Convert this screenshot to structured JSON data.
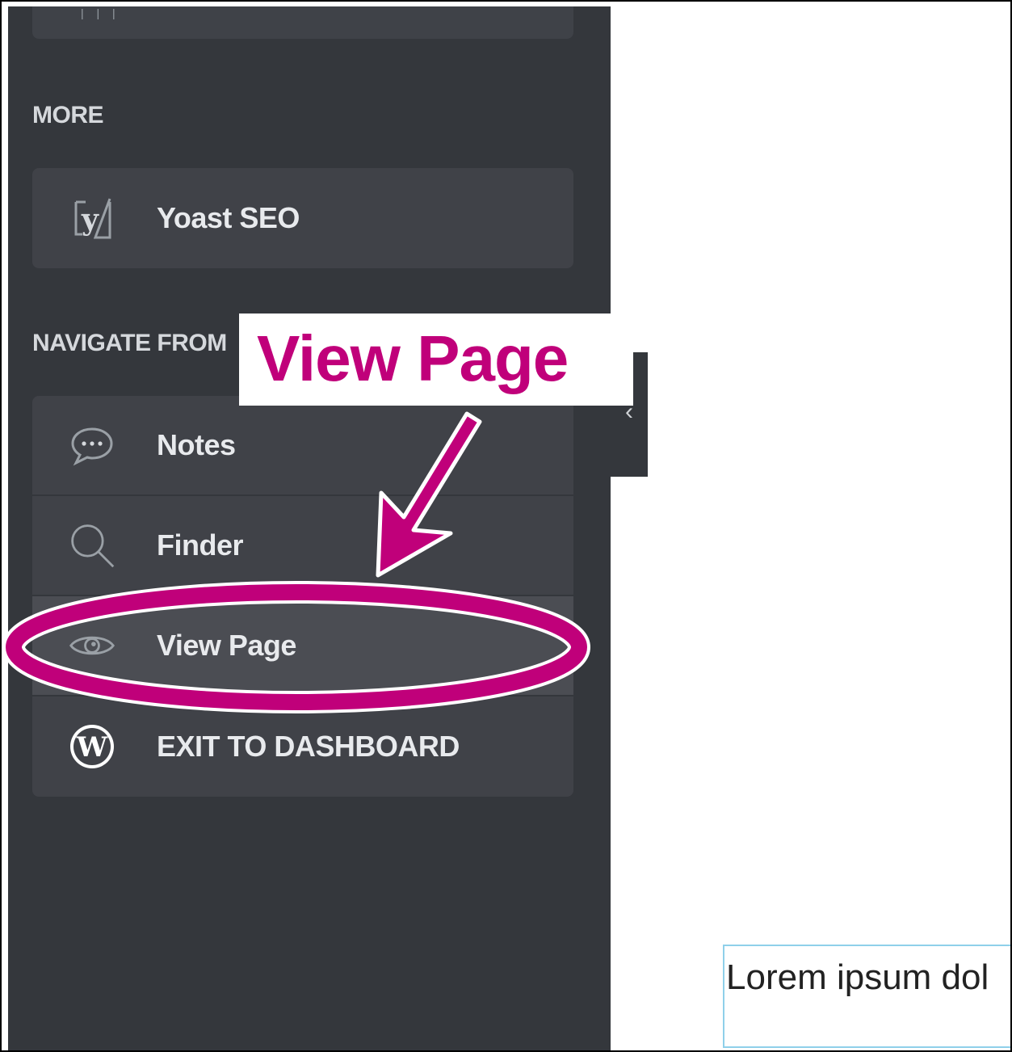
{
  "sidebar": {
    "more_heading": "MORE",
    "more_items": [
      {
        "label": "Yoast SEO",
        "icon": "yoast-icon"
      }
    ],
    "navigate_heading": "NAVIGATE FROM",
    "navigate_items": [
      {
        "label": "Notes",
        "icon": "chat-bubble-icon"
      },
      {
        "label": "Finder",
        "icon": "search-icon"
      },
      {
        "label": "View Page",
        "icon": "eye-icon"
      },
      {
        "label": "EXIT TO DASHBOARD",
        "icon": "wordpress-icon"
      }
    ]
  },
  "collapse_tab": {
    "glyph": "‹"
  },
  "canvas": {
    "preview_text": "Lorem ipsum dol"
  },
  "annotation": {
    "callout_text": "View Page",
    "color": "#c0007a"
  },
  "colors": {
    "sidebar_bg": "#34373c",
    "panel_bg": "#404248",
    "active_bg": "#4b4d53",
    "text": "#e8eaed",
    "highlight": "#c0007a",
    "input_border": "#8fd0ea"
  }
}
